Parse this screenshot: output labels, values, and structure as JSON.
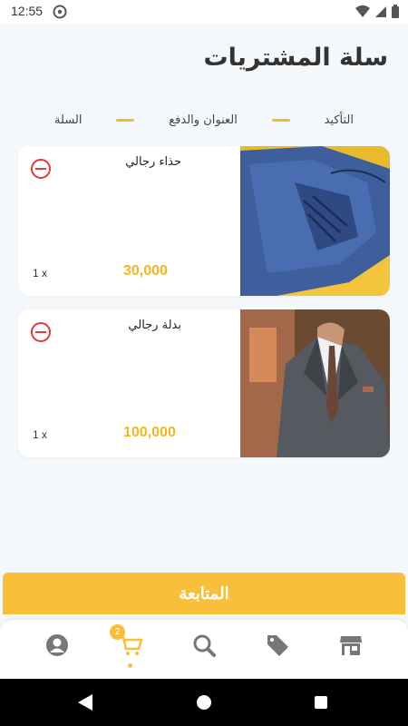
{
  "status_bar": {
    "time": "12:55",
    "icons": [
      "notification-icon",
      "wifi-icon",
      "signal-icon",
      "battery-icon"
    ]
  },
  "page": {
    "title": "سلة المشتريات"
  },
  "stepper": {
    "steps": [
      "التأكيد",
      "العنوان والدفع",
      "السلة"
    ]
  },
  "cart_items": [
    {
      "name": "حذاء رجالي",
      "price": "30,000",
      "quantity": "1 x",
      "image": "blue-suede-shoe"
    },
    {
      "name": "بدلة رجالي",
      "price": "100,000",
      "quantity": "1 x",
      "image": "grey-suit"
    }
  ],
  "actions": {
    "continue_label": "المتابعة"
  },
  "bottom_nav": {
    "items": [
      "profile-icon",
      "cart-icon",
      "search-icon",
      "tag-icon",
      "store-icon"
    ],
    "cart_badge": "2",
    "active": "cart"
  },
  "colors": {
    "accent": "#f9bf3a",
    "price": "#f4b61d",
    "remove": "#e23a3a",
    "background": "#f5f8fb"
  }
}
